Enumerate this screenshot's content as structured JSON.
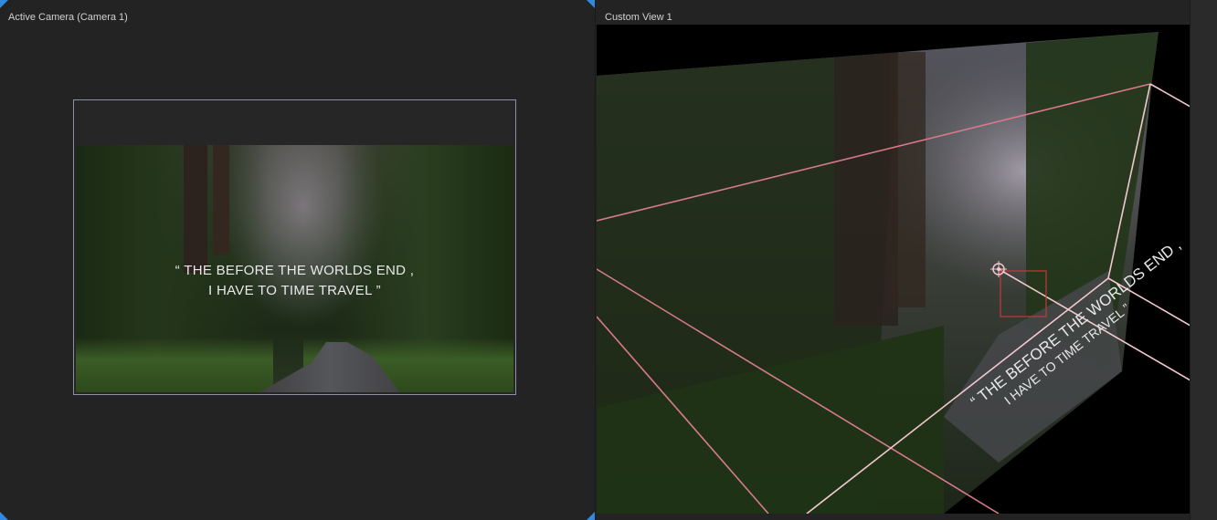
{
  "left_panel": {
    "title": "Active Camera (Camera 1)",
    "quote_line1": "“ THE BEFORE THE WORLDS END ,",
    "quote_line2": "I HAVE TO TIME TRAVEL  ”"
  },
  "right_panel": {
    "title": "Custom View 1",
    "quote_line1": "“ THE BEFORE THE WORLDS END ,",
    "quote_line2": "I HAVE TO TIME TRAVEL  ”"
  },
  "colors": {
    "accent_corner": "#2f8ae0",
    "camera_frustum": "#d77a8a",
    "light_lines": "#f3c8cf",
    "frame_border": "#8d8fa6",
    "selection_box": "#c23a3a"
  },
  "icons": {
    "camera_target": "crosshair-icon"
  }
}
